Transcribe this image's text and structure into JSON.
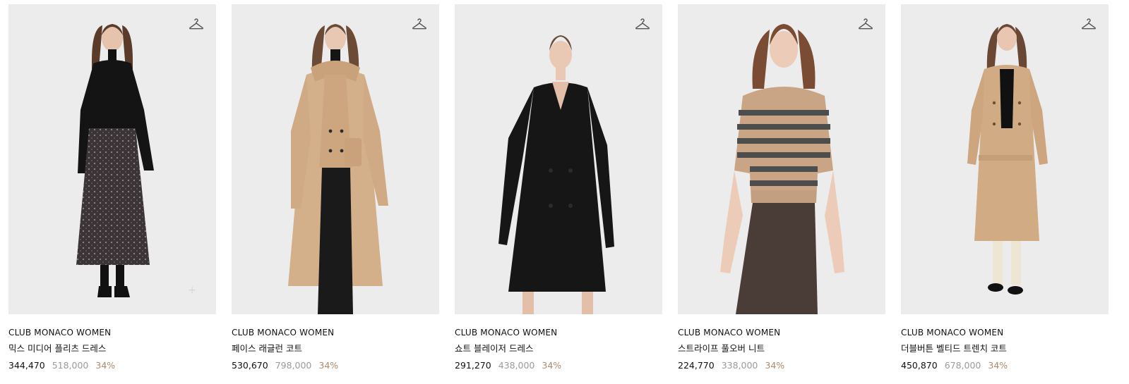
{
  "icons": {
    "wishlist": "hanger-icon",
    "quick_add": "plus-icon"
  },
  "colors": {
    "discount": "#b08a6a",
    "original_price": "#9a9a9a",
    "image_bg": "#ececec"
  },
  "products": [
    {
      "brand": "CLUB MONACO WOMEN",
      "name": "믹스 미디어 플리츠 드레스",
      "price": "344,470",
      "original_price": "518,000",
      "discount": "34%"
    },
    {
      "brand": "CLUB MONACO WOMEN",
      "name": "페이스 래글런 코트",
      "price": "530,670",
      "original_price": "798,000",
      "discount": "34%"
    },
    {
      "brand": "CLUB MONACO WOMEN",
      "name": "쇼트 블레이저 드레스",
      "price": "291,270",
      "original_price": "438,000",
      "discount": "34%"
    },
    {
      "brand": "CLUB MONACO WOMEN",
      "name": "스트라이프 풀오버 니트",
      "price": "224,770",
      "original_price": "338,000",
      "discount": "34%"
    },
    {
      "brand": "CLUB MONACO WOMEN",
      "name": "더블버튼 벨티드 트렌치 코트",
      "price": "450,870",
      "original_price": "678,000",
      "discount": "34%"
    }
  ]
}
